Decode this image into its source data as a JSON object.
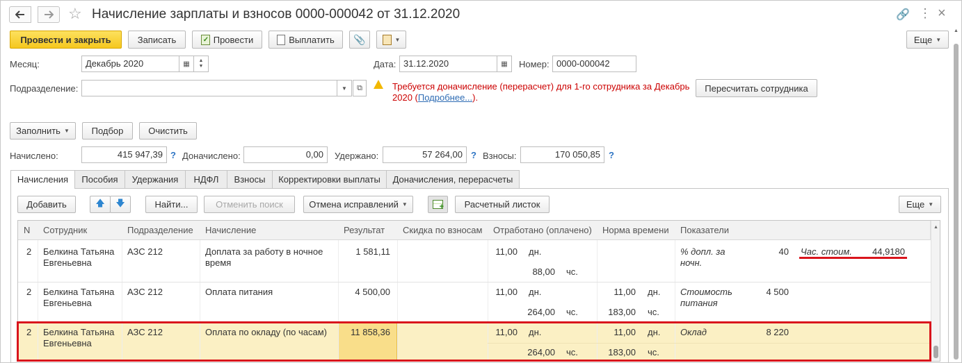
{
  "title": "Начисление зарплаты и взносов 0000-000042 от 31.12.2020",
  "toolbar": {
    "post_close": "Провести и закрыть",
    "save": "Записать",
    "post": "Провести",
    "pay": "Выплатить",
    "more": "Еще"
  },
  "header": {
    "month_label": "Месяц:",
    "month_value": "Декабрь 2020",
    "date_label": "Дата:",
    "date_value": "31.12.2020",
    "number_label": "Номер:",
    "number_value": "0000-000042",
    "division_label": "Подразделение:",
    "division_value": "",
    "warning_text": "Требуется доначисление (перерасчет) для 1-го сотрудника за Декабрь 2020 (",
    "warning_link": "Подробнее...",
    "warning_tail": ").",
    "recalc_button": "Пересчитать сотрудника"
  },
  "actions": {
    "fill": "Заполнить",
    "select": "Подбор",
    "clear": "Очистить"
  },
  "totals": {
    "accrued_label": "Начислено:",
    "accrued": "415 947,39",
    "extra_label": "Доначислено:",
    "extra": "0,00",
    "withheld_label": "Удержано:",
    "withheld": "57 264,00",
    "contrib_label": "Взносы:",
    "contrib": "170 050,85",
    "help": "?"
  },
  "tabs": [
    "Начисления",
    "Пособия",
    "Удержания",
    "НДФЛ",
    "Взносы",
    "Корректировки выплаты",
    "Доначисления, перерасчеты"
  ],
  "table_toolbar": {
    "add": "Добавить",
    "find": "Найти...",
    "cancel_search": "Отменить поиск",
    "cancel_fix": "Отмена исправлений",
    "payslip": "Расчетный листок",
    "more": "Еще"
  },
  "columns": [
    "N",
    "Сотрудник",
    "Подразделение",
    "Начисление",
    "Результат",
    "Скидка по взносам",
    "Отработано (оплачено)",
    "Норма времени",
    "Показатели"
  ],
  "rows": [
    {
      "n": "2",
      "emp1": "Белкина Татьяна",
      "emp2": "Евгеньевна",
      "div": "АЗС 212",
      "acc1": "Доплата за работу в ночное",
      "acc2": "время",
      "result": "1 581,11",
      "days": "11,00",
      "days_u": "дн.",
      "hours": "88,00",
      "hours_u": "чс.",
      "norm_d": "",
      "norm_du": "",
      "norm_h": "",
      "norm_hu": "",
      "ind1_name1": "% допл. за",
      "ind1_name2": "ночн.",
      "ind1_val": "40",
      "ind2_name": "Час. стоим.",
      "ind2_val": "44,9180"
    },
    {
      "n": "2",
      "emp1": "Белкина Татьяна",
      "emp2": "Евгеньевна",
      "div": "АЗС 212",
      "acc1": "Оплата питания",
      "acc2": "",
      "result": "4 500,00",
      "days": "11,00",
      "days_u": "дн.",
      "hours": "264,00",
      "hours_u": "чс.",
      "norm_d": "11,00",
      "norm_du": "дн.",
      "norm_h": "183,00",
      "norm_hu": "чс.",
      "ind1_name1": "Стоимость",
      "ind1_name2": "питания",
      "ind1_val": "4 500",
      "ind2_name": "",
      "ind2_val": ""
    },
    {
      "n": "2",
      "emp1": "Белкина Татьяна",
      "emp2": "Евгеньевна",
      "div": "АЗС 212",
      "acc1": "Оплата по окладу (по часам)",
      "acc2": "",
      "result": "11 858,36",
      "days": "11,00",
      "days_u": "дн.",
      "hours": "264,00",
      "hours_u": "чс.",
      "norm_d": "11,00",
      "norm_du": "дн.",
      "norm_h": "183,00",
      "norm_hu": "чс.",
      "ind1_name1": "Оклад",
      "ind1_name2": "",
      "ind1_val": "8 220",
      "ind2_name": "",
      "ind2_val": ""
    }
  ],
  "colors": {
    "primary": "#f5c71e",
    "warning": "#cc0000",
    "link": "#2e6cb4",
    "selected_row": "#fbf0c4",
    "selected_cell": "#f9de8a",
    "highlight": "#d9141c"
  }
}
